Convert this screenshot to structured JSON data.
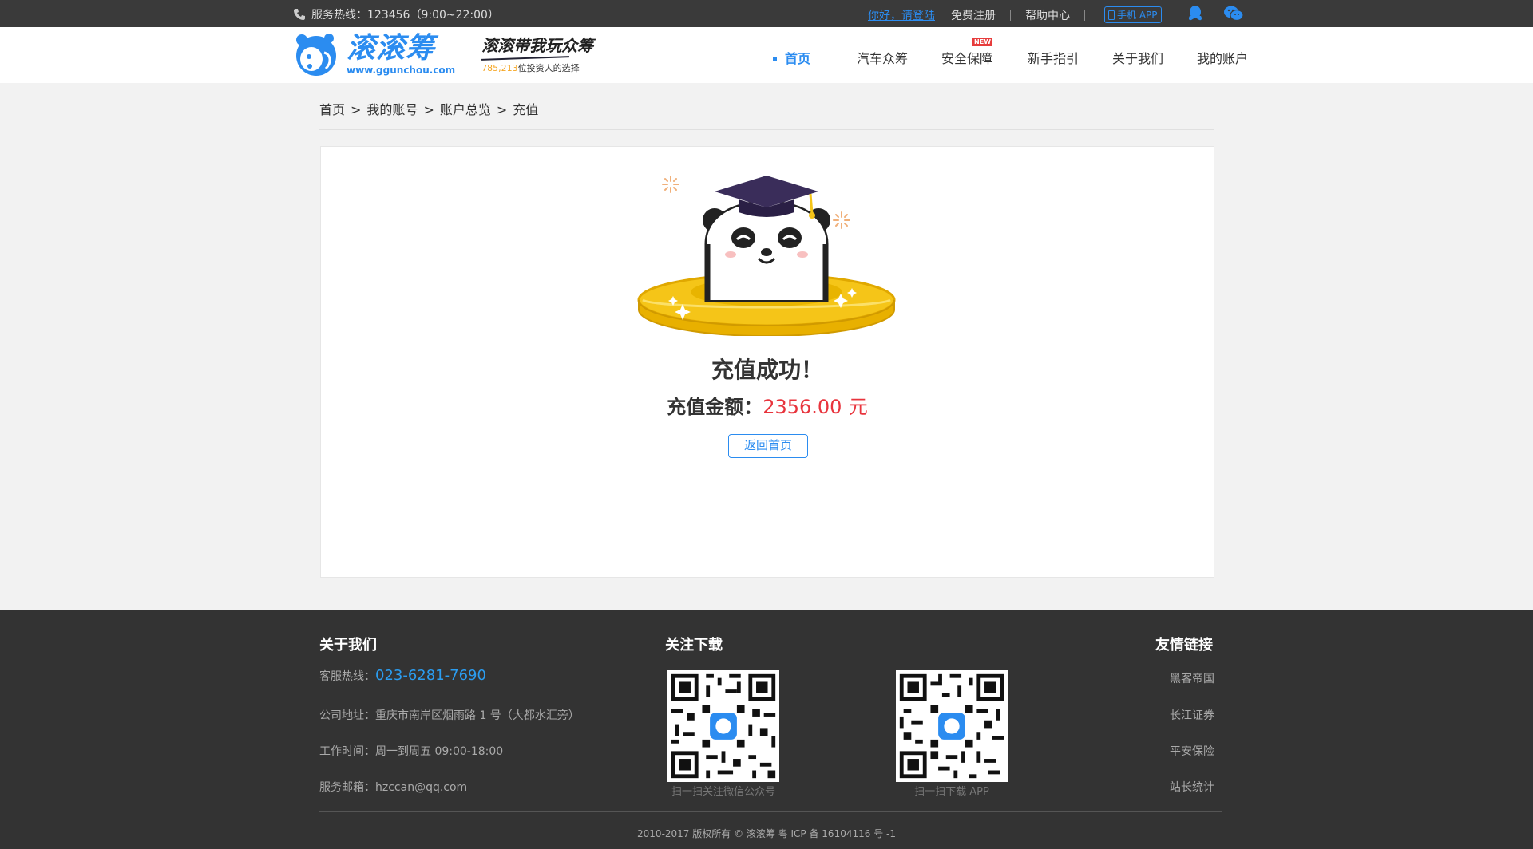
{
  "topbar": {
    "hotline": "服务热线：123456（9:00~22:00）",
    "login": "你好，请登陆",
    "register": "免费注册",
    "help": "帮助中心",
    "app": "手机 APP"
  },
  "header": {
    "brand_name": "滚滚筹",
    "brand_url": "www.ggunchou.com",
    "slogan": "滚滚带我玩众筹",
    "investor_count": "785,213",
    "investor_text": "位投资人的选择",
    "nav": [
      {
        "label": "首页",
        "active": true
      },
      {
        "label": "汽车众筹"
      },
      {
        "label": "安全保障",
        "badge": "NEW"
      },
      {
        "label": "新手指引"
      },
      {
        "label": "关于我们"
      },
      {
        "label": "我的账户"
      }
    ]
  },
  "breadcrumb": [
    "首页",
    "我的账号",
    "账户总览",
    "充值"
  ],
  "result": {
    "title": "充值成功！",
    "amount_label": "充值金额：",
    "amount": "2356.00",
    "unit": "元",
    "back_button": "返回首页"
  },
  "footer": {
    "about_title": "关于我们",
    "hotline_label": "客服热线：",
    "hotline": "023-6281-7690",
    "address": "公司地址：重庆市南岸区烟雨路 1 号（大都水汇旁）",
    "hours": "工作时间：周一到周五  09:00-18:00",
    "email": "服务邮箱：hzccan@qq.com",
    "follow_title": "关注下载",
    "qr_wechat_caption": "扫一扫关注微信公众号",
    "qr_app_caption": "扫一扫下载 APP",
    "links_title": "友情链接",
    "links": [
      "黑客帝国",
      "长江证券",
      "平安保险",
      "站长统计"
    ],
    "copyright": "2010-2017 版权所有 © 滚滚筹 粤 ICP 备 16104116 号 -1"
  },
  "colors": {
    "accent": "#2b8cf0",
    "amount": "#e8343d",
    "footer_bg": "#333333",
    "topbar_bg": "#3a3a3a"
  }
}
